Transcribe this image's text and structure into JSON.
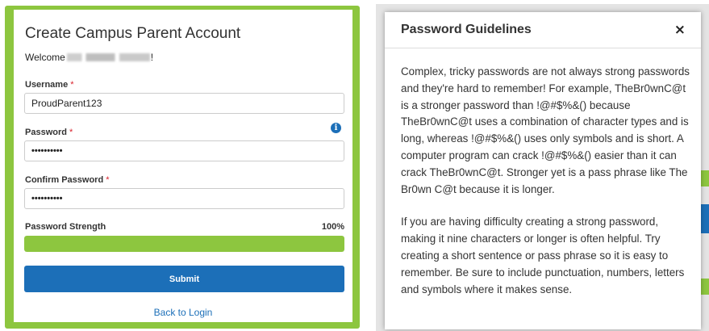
{
  "form": {
    "title": "Create Campus Parent Account",
    "welcome_prefix": "Welcome",
    "welcome_suffix": "!",
    "username_label": "Username",
    "username_value": "ProudParent123",
    "password_label": "Password",
    "password_value": "••••••••••",
    "confirm_label": "Confirm Password",
    "confirm_value": "••••••••••",
    "required_mark": "*",
    "strength_label": "Password Strength",
    "strength_text": "100%",
    "strength_fraction": 1.0,
    "submit_label": "Submit",
    "back_label": "Back to Login",
    "info_glyph": "i"
  },
  "modal": {
    "title": "Password Guidelines",
    "close_glyph": "×",
    "paragraph_1": "Complex, tricky passwords are not always strong passwords and they're hard to remember! For example, TheBr0wnC@t is a stronger password than !@#$%&() because TheBr0wnC@t uses a combination of character types and is long, whereas !@#$%&() uses only symbols and is short. A computer program can crack !@#$%&() easier than it can crack TheBr0wnC@t. Stronger yet is a pass phrase like The Br0wn C@t because it is longer.",
    "paragraph_2": "If you are having difficulty creating a strong password, making it nine characters or longer is often helpful. Try creating a short sentence or pass phrase so it is easy to remember. Be sure to include punctuation, numbers, letters and symbols where it makes sense."
  },
  "colors": {
    "brand_green": "#8dc63f",
    "primary_blue": "#1c6fb8",
    "required_red": "#d9232d"
  },
  "icons": {
    "info": "info-circle-icon",
    "close": "close-icon"
  }
}
